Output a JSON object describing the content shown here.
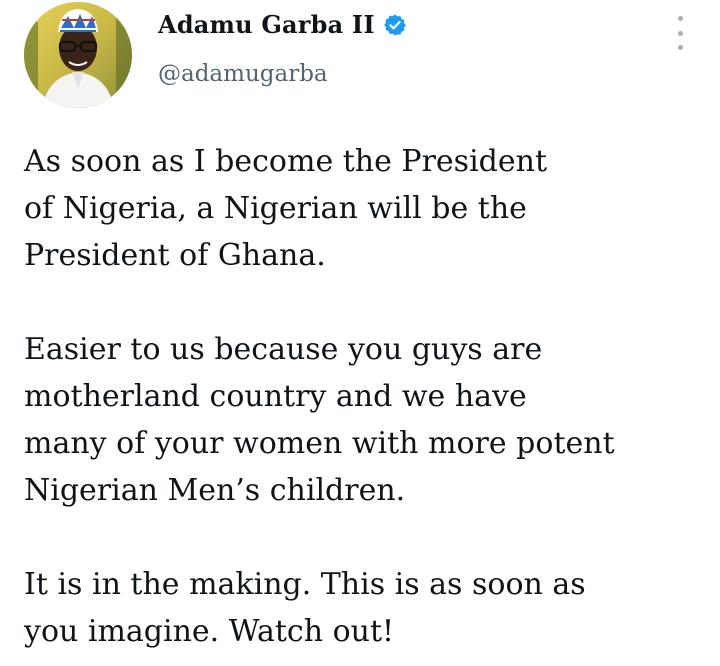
{
  "author": {
    "display_name": "Adamu Garba II",
    "handle": "@adamugarba",
    "verified": true,
    "verified_color": "#1d9bf0"
  },
  "icons": {
    "more": "more-vertical-icon",
    "verified": "verified-badge-icon"
  },
  "tweet": {
    "paragraphs": [
      {
        "lines": [
          "As soon as I become the President",
          "of Nigeria, a Nigerian will be the",
          "President of Ghana."
        ]
      },
      {
        "lines": [
          "Easier to us because you guys are",
          "motherland country and we have",
          "many of your women with more potent",
          "Nigerian Men’s children."
        ]
      },
      {
        "lines": [
          "It is in the making. This is as soon as",
          "you imagine. Watch out!"
        ]
      }
    ]
  }
}
